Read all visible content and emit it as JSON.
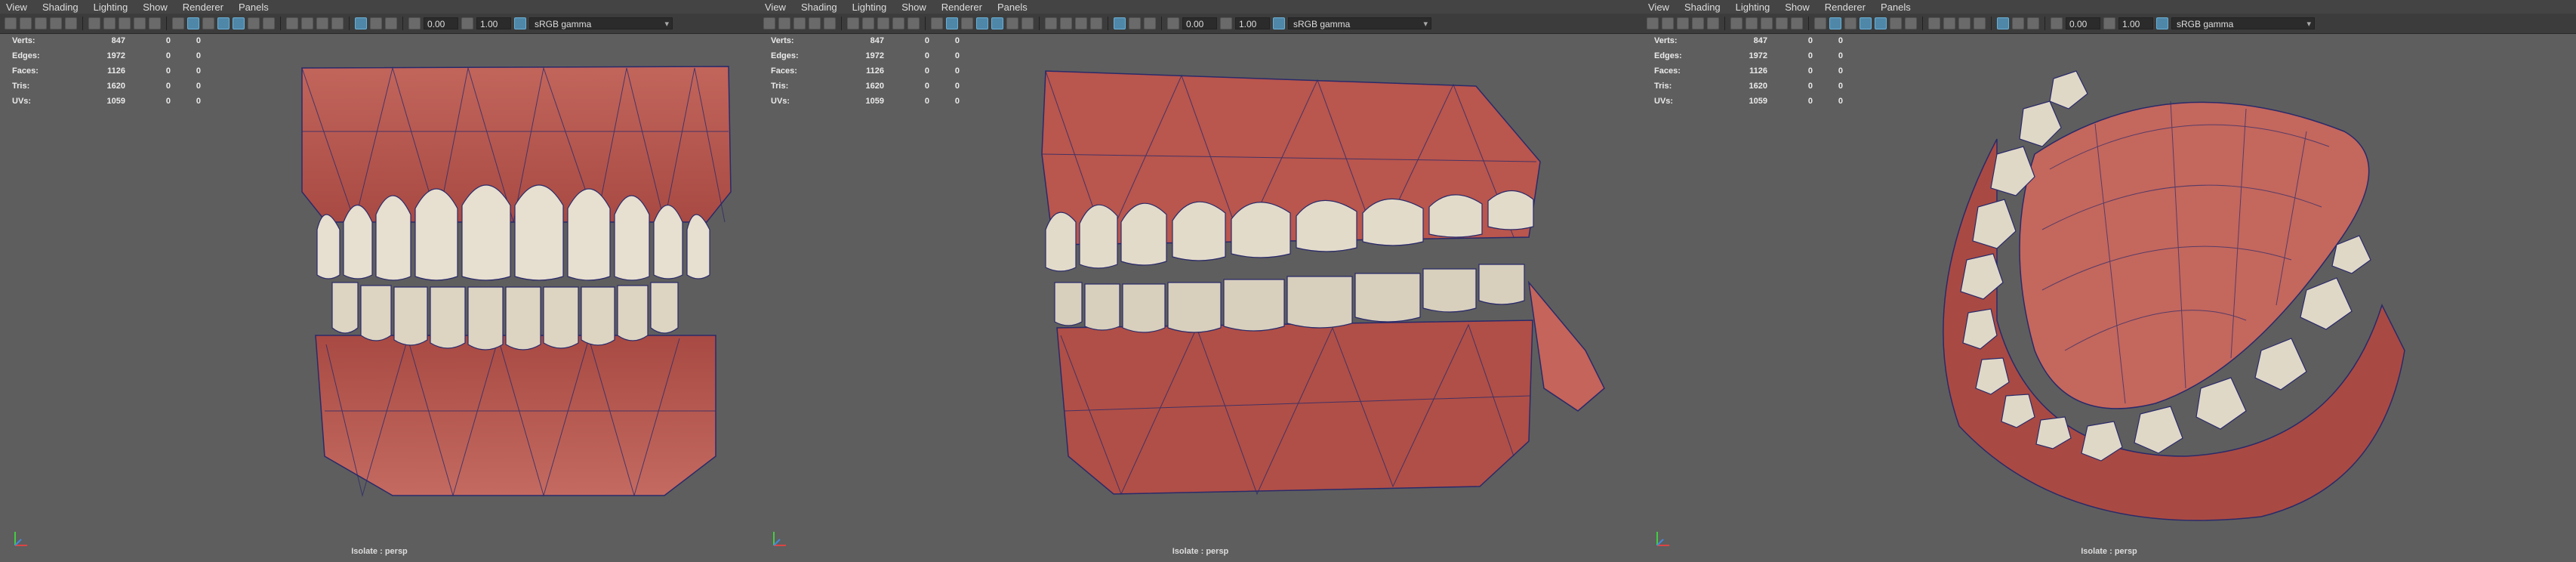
{
  "menu": [
    "View",
    "Shading",
    "Lighting",
    "Show",
    "Renderer",
    "Panels"
  ],
  "toolbar": {
    "exposure": "0.00",
    "gamma": "1.00",
    "color_space": "sRGB gamma"
  },
  "hud": {
    "rows": [
      {
        "label": "Verts:",
        "v1": "847",
        "v2": "0",
        "v3": "0"
      },
      {
        "label": "Edges:",
        "v1": "1972",
        "v2": "0",
        "v3": "0"
      },
      {
        "label": "Faces:",
        "v1": "1126",
        "v2": "0",
        "v3": "0"
      },
      {
        "label": "Tris:",
        "v1": "1620",
        "v2": "0",
        "v3": "0"
      },
      {
        "label": "UVs:",
        "v1": "1059",
        "v2": "0",
        "v3": "0"
      }
    ]
  },
  "camera_label": "Isolate : persp",
  "colors": {
    "gum": "#b9564d",
    "gum_dark": "#8e3a35",
    "tooth": "#e7dfcf",
    "wire": "#2a2a6a",
    "background": "#5e5e5e"
  },
  "viewports": [
    {
      "name": "front"
    },
    {
      "name": "side"
    },
    {
      "name": "top"
    }
  ]
}
